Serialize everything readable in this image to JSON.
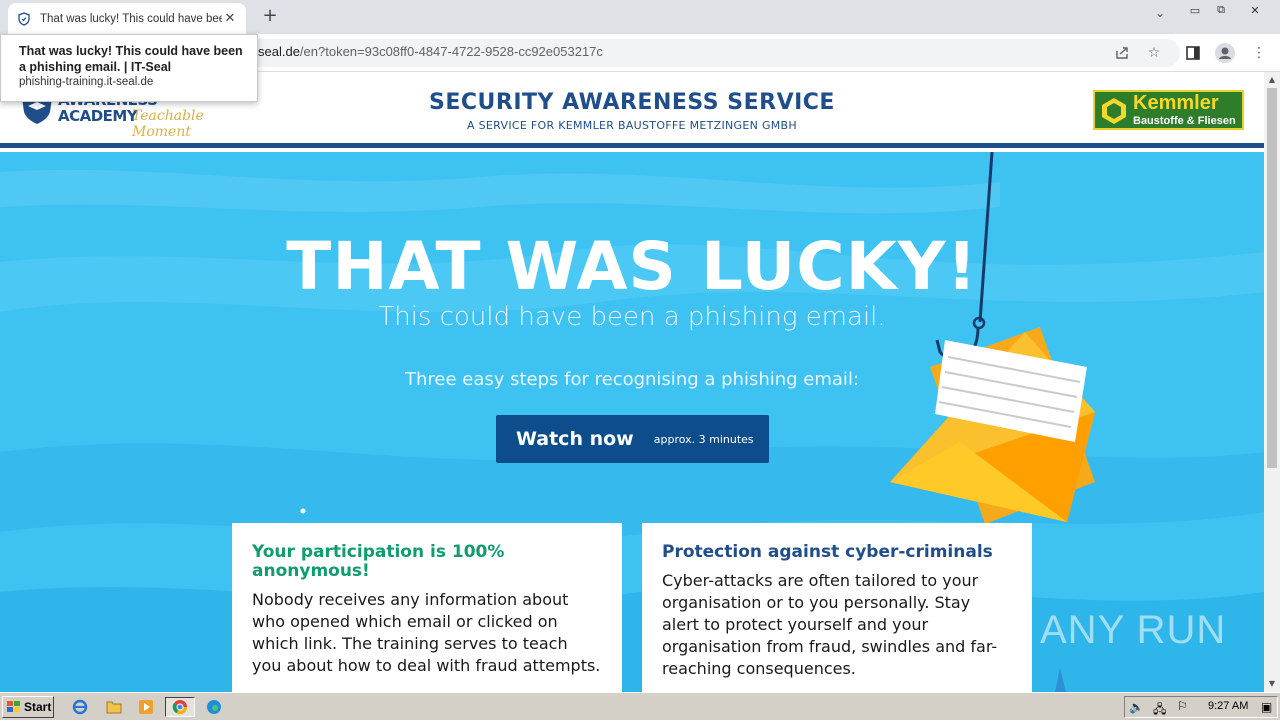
{
  "browser": {
    "tab_title": "That was lucky! This could have bee",
    "url_host_prefix": "seal.de",
    "url_path": "/en?token=93c08ff0-4847-4722-9528-cc92e053217c",
    "hovercard_title": "That was lucky! This could have been a phishing email. | IT-Seal",
    "hovercard_url": "phishing-training.it-seal.de"
  },
  "header": {
    "logo_line1": "AWARENESS",
    "logo_line2": "ACADEMY",
    "logo_tagline": "Teachable Moment",
    "title": "SECURITY AWARENESS SERVICE",
    "subtitle": "A SERVICE FOR KEMMLER BAUSTOFFE METZINGEN GMBH",
    "partner_name": "Kemmler",
    "partner_sub": "Baustoffe & Fliesen"
  },
  "hero": {
    "headline": "THAT WAS LUCKY!",
    "subline": "This could have been a phishing email.",
    "steps": "Three easy steps for recognising a phishing email:",
    "watch_label": "Watch now",
    "watch_duration": "approx. 3 minutes"
  },
  "cards": [
    {
      "title": "Your participation is 100% anonymous!",
      "body": "Nobody receives any information about who opened which email or clicked on which link. The training serves to teach you about how to deal with fraud attempts."
    },
    {
      "title": "Protection against cyber-criminals",
      "body": "Cyber-attacks are often tailored to your organisation or to you personally. Stay alert to protect yourself and your organisation from fraud, swindles and far-reaching consequences."
    }
  ],
  "watermark": "ANY RUN",
  "taskbar": {
    "start_label": "Start",
    "clock": "9:27 AM"
  },
  "colors": {
    "brand_blue": "#1f4e8a",
    "hero_blue": "#3ec2f2",
    "button_blue": "#0d4d8c",
    "accent_green": "#0f9c6f",
    "kemmler_green": "#2d7d2a",
    "kemmler_yellow": "#f5d82a"
  }
}
